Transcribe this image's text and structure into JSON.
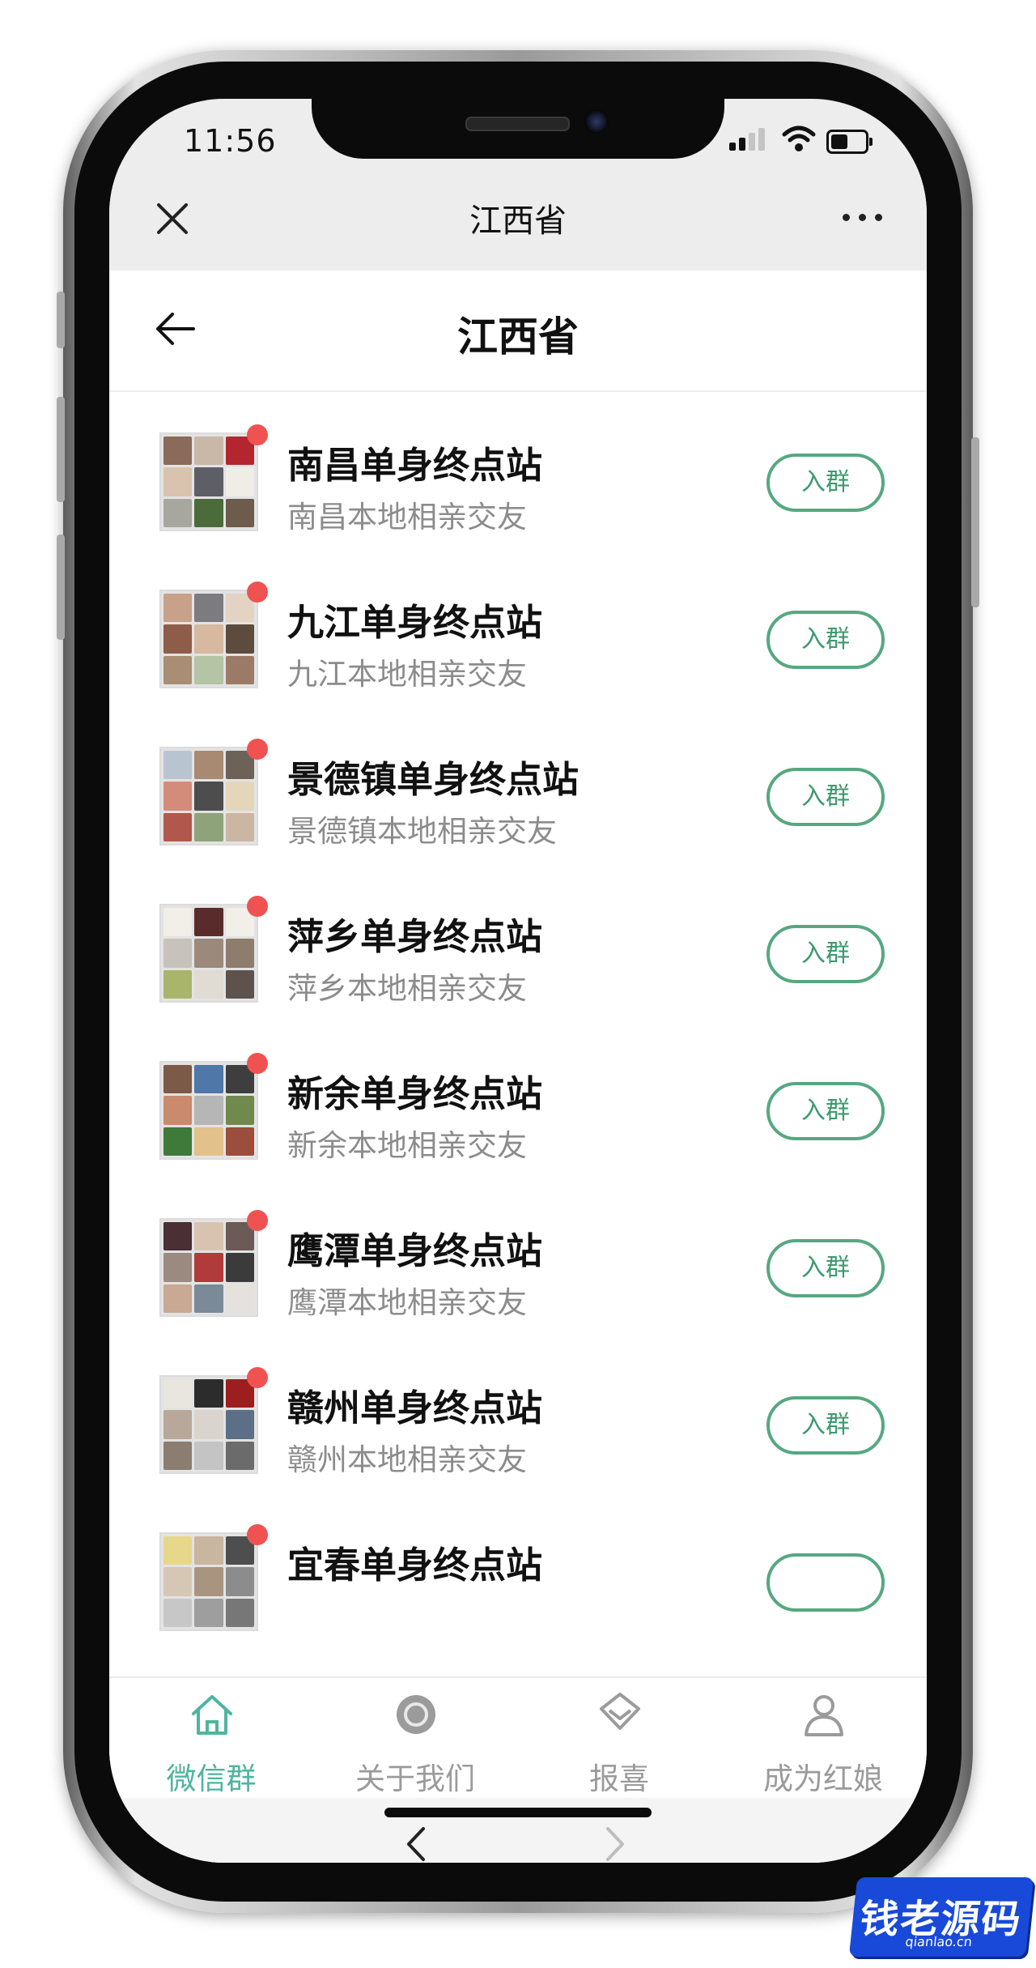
{
  "status_bar": {
    "time": "11:56"
  },
  "wechat_nav": {
    "title": "江西省",
    "close_icon": "close-icon",
    "more_icon": "more-icon"
  },
  "page": {
    "title": "江西省",
    "back_icon": "back-arrow-icon"
  },
  "groups": [
    {
      "name": "南昌单身终点站",
      "desc": "南昌本地相亲交友",
      "button": "入群"
    },
    {
      "name": "九江单身终点站",
      "desc": "九江本地相亲交友",
      "button": "入群"
    },
    {
      "name": "景德镇单身终点站",
      "desc": "景德镇本地相亲交友",
      "button": "入群"
    },
    {
      "name": "萍乡单身终点站",
      "desc": "萍乡本地相亲交友",
      "button": "入群"
    },
    {
      "name": "新余单身终点站",
      "desc": "新余本地相亲交友",
      "button": "入群"
    },
    {
      "name": "鹰潭单身终点站",
      "desc": "鹰潭本地相亲交友",
      "button": "入群"
    },
    {
      "name": "赣州单身终点站",
      "desc": "赣州本地相亲交友",
      "button": "入群"
    },
    {
      "name": "宜春单身终点站",
      "desc": "",
      "button": ""
    }
  ],
  "tab_bar": {
    "items": [
      {
        "label": "微信群",
        "icon": "home-icon",
        "active": true
      },
      {
        "label": "关于我们",
        "icon": "info-circle-icon",
        "active": false
      },
      {
        "label": "报喜",
        "icon": "diamond-icon",
        "active": false
      },
      {
        "label": "成为红娘",
        "icon": "user-icon",
        "active": false
      }
    ]
  },
  "browser_toolbar": {
    "back_icon": "chevron-left-icon",
    "forward_icon": "chevron-right-icon"
  },
  "watermark": {
    "text": "钱老源码",
    "sub": "qianlao.cn"
  },
  "colors": {
    "accent": "#4fb59f",
    "button_border": "#56a880",
    "red_dot": "#f05252",
    "nav_bg": "#ededed"
  }
}
